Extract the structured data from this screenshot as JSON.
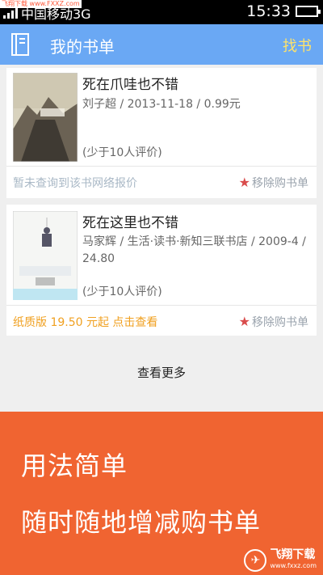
{
  "status_bar": {
    "carrier": "中国移动3G",
    "time": "15:33",
    "watermark": "飞翔下载 www.FXXZ.com"
  },
  "app_bar": {
    "title": "我的书单",
    "action": "找书"
  },
  "books": [
    {
      "title": "死在爪哇也不错",
      "meta": "刘子超 / 2013-11-18 / 0.99元",
      "rating": "(少于10人评价)",
      "price_note": "暂未查询到该书网络报价",
      "price_note_color": "#a9b8c6",
      "remove_label": "移除购书单"
    },
    {
      "title": "死在这里也不错",
      "meta": "马家辉 / 生活·读书·新知三联书店 / 2009-4 / 24.80",
      "rating": "(少于10人评价)",
      "price_note": "纸质版 19.50 元起 点击查看",
      "price_note_color": "#f0a020",
      "remove_label": "移除购书单"
    }
  ],
  "more_label": "查看更多",
  "promo": {
    "line1": "用法简单",
    "line2": "随时随地增减购书单",
    "logo_main": "飞翔下载",
    "logo_sub": "www.fxxz.com"
  },
  "colors": {
    "app_bar": "#6aa8f4",
    "action": "#ffe36a",
    "promo": "#f06431",
    "star": "#d94c4c"
  },
  "battery_level": 1.0
}
